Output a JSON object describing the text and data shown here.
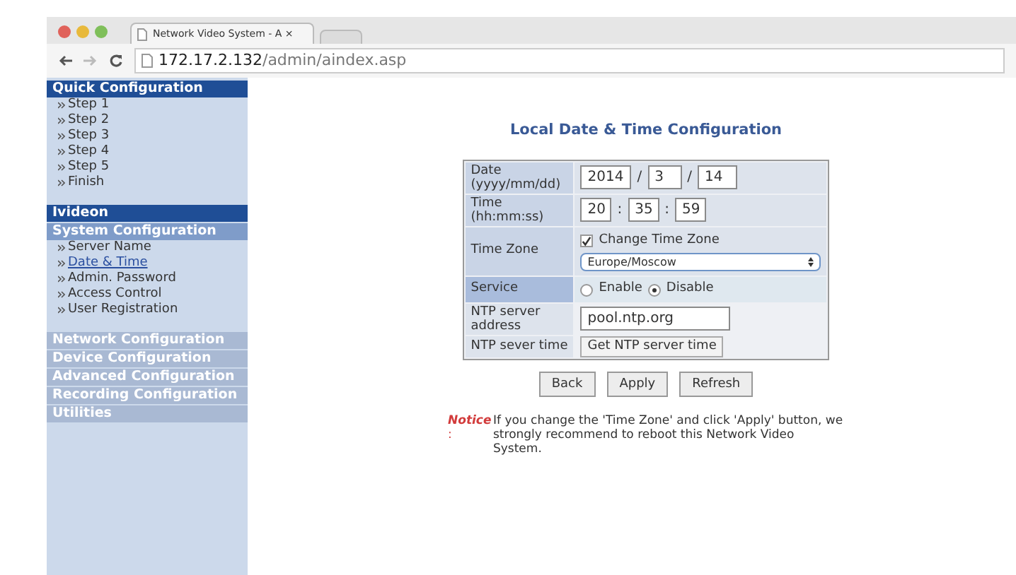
{
  "browser": {
    "tab_title": "Network Video System - A ×",
    "url_host": "172.17.2.132",
    "url_path": "/admin/aindex.asp"
  },
  "sidebar": {
    "sections": [
      {
        "title": "Quick Configuration",
        "kind": "dark",
        "items": [
          {
            "label": "Step 1",
            "selected": false
          },
          {
            "label": "Step 2",
            "selected": false
          },
          {
            "label": "Step 3",
            "selected": false
          },
          {
            "label": "Step 4",
            "selected": false
          },
          {
            "label": "Step 5",
            "selected": false
          },
          {
            "label": "Finish",
            "selected": false
          }
        ]
      },
      {
        "title": "Ivideon",
        "kind": "dark"
      },
      {
        "title": "System Configuration",
        "kind": "medium",
        "items": [
          {
            "label": "Server Name",
            "selected": false
          },
          {
            "label": "Date & Time",
            "selected": true
          },
          {
            "label": "Admin. Password",
            "selected": false
          },
          {
            "label": "Access Control",
            "selected": false
          },
          {
            "label": "User Registration",
            "selected": false
          }
        ]
      },
      {
        "title": "Network Configuration",
        "kind": "light"
      },
      {
        "title": "Device Configuration",
        "kind": "light"
      },
      {
        "title": "Advanced Configuration",
        "kind": "light"
      },
      {
        "title": "Recording Configuration",
        "kind": "light"
      },
      {
        "title": "Utilities",
        "kind": "light"
      }
    ]
  },
  "main": {
    "title": "Local Date & Time Configuration",
    "date": {
      "label": "Date (yyyy/mm/dd)",
      "year": "2014",
      "month": "3",
      "day": "14",
      "separator": "/"
    },
    "time": {
      "label": "Time (hh:mm:ss)",
      "hour": "20",
      "minute": "35",
      "second": "59",
      "separator": ":"
    },
    "time_zone": {
      "label": "Time Zone",
      "change_label": "Change Time Zone",
      "checked": true,
      "value": "Europe/Moscow"
    },
    "service": {
      "label": "Service",
      "options": [
        {
          "label": "Enable",
          "selected": false
        },
        {
          "label": "Disable",
          "selected": true
        }
      ]
    },
    "ntp_address": {
      "label": "NTP server address",
      "value": "pool.ntp.org"
    },
    "ntp_time": {
      "label": "NTP sever time",
      "button": "Get NTP server time"
    },
    "buttons": [
      "Back",
      "Apply",
      "Refresh"
    ],
    "notice": {
      "label": "Notice",
      "colon": ":",
      "text": "If you change the 'Time Zone' and click 'Apply' button, we strongly recommend to reboot this Network Video System."
    }
  }
}
